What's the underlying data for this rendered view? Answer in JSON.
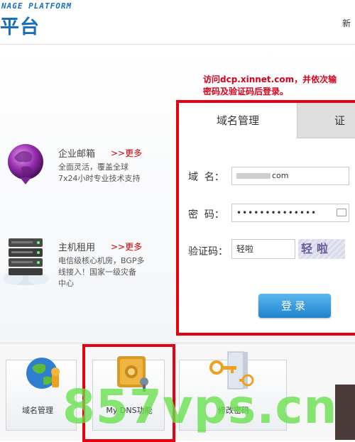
{
  "header": {
    "brand_en": "NAGE PLATFORM",
    "brand_cn": "平台",
    "right_link": "新"
  },
  "notice": {
    "line1": "访问dcp.xinnet.com，并依次输",
    "line2": "密码及验证码后登录。"
  },
  "services": [
    {
      "title": "企业邮箱",
      "more": ">>更多",
      "desc": [
        "全面灵活，覆盖全球",
        "7x24小时专业技术支持"
      ],
      "icon": "mail-globe-icon"
    },
    {
      "title": "主机租用",
      "more": ">>更多",
      "desc": [
        "电信级核心机房，BGP多",
        "线接入！国家一级灾备",
        "中心"
      ],
      "icon": "server-icon"
    }
  ],
  "login": {
    "tabs": [
      {
        "label": "域名管理",
        "active": true
      },
      {
        "label": "证",
        "active": false
      }
    ],
    "domain_label": "域  名：",
    "domain_value": "com",
    "password_label": "密  码：",
    "password_value": "••••••••••••••",
    "captcha_label": "验证码：",
    "captcha_value": "轻啦",
    "captcha_image_text": "轻啦",
    "submit_label": "登录"
  },
  "bottom_cards": [
    {
      "label": "域名管理",
      "icon": "globe-icon"
    },
    {
      "label": "My DNS功能",
      "icon": "dns-safe-icon"
    },
    {
      "label": "修改密码",
      "icon": "key-door-icon"
    }
  ],
  "watermark": "857vps.cn",
  "colors": {
    "brand_blue": "#1a6fb8",
    "highlight_red": "#e60012",
    "button_blue": "#1f84cc",
    "watermark_green": "#66e04a"
  }
}
